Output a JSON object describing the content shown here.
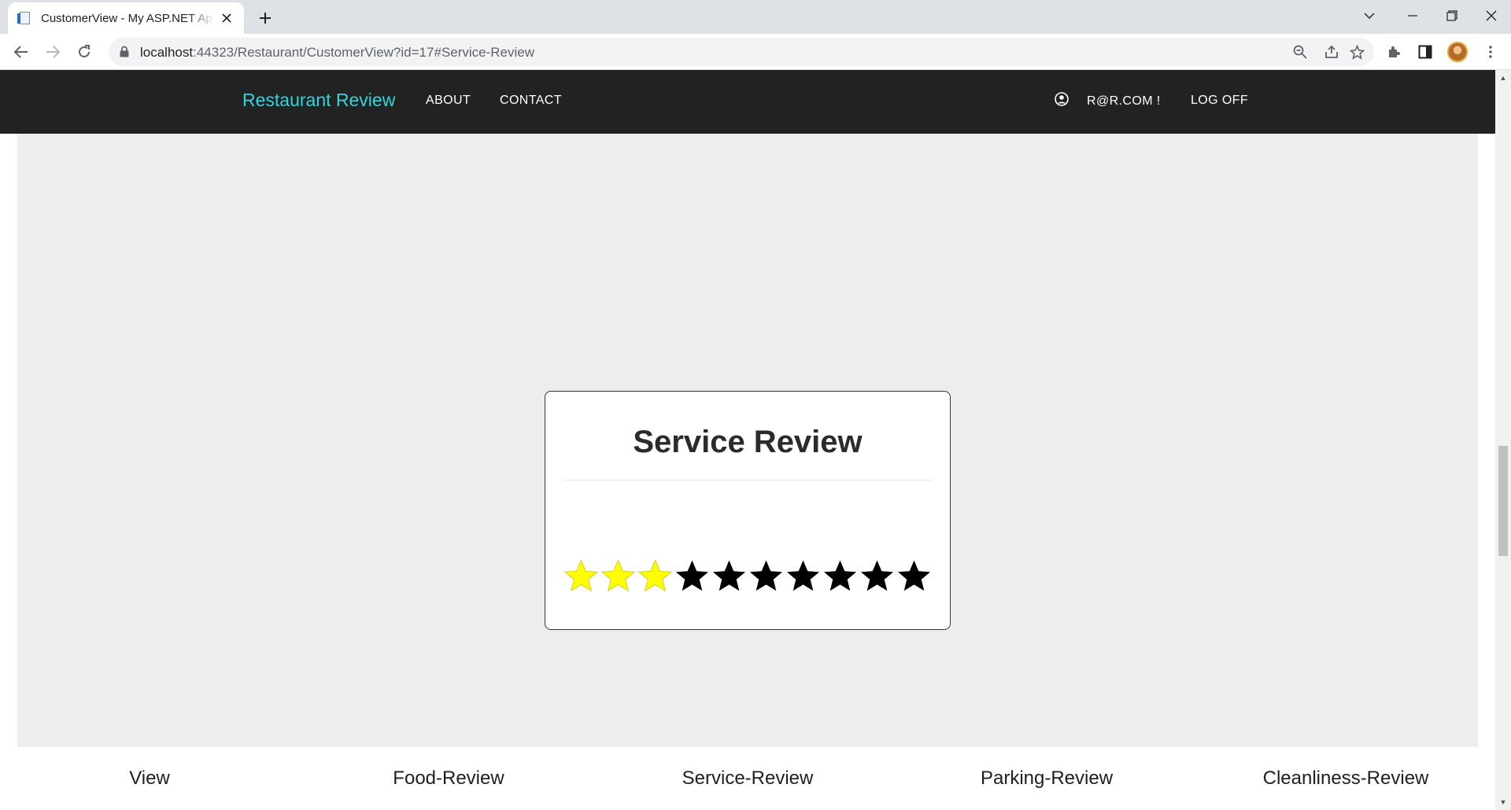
{
  "browser": {
    "tab_title": "CustomerView - My ASP.NET Application",
    "url_host": "localhost",
    "url_rest": ":44323/Restaurant/CustomerView?id=17#Service-Review"
  },
  "navbar": {
    "brand": "Restaurant Review",
    "links": [
      "ABOUT",
      "CONTACT"
    ],
    "user": "R@R.COM !",
    "logoff": "LOG OFF"
  },
  "review": {
    "title": "Service Review",
    "rating": 3,
    "max_rating": 10,
    "filled_color": "#ffff00",
    "empty_color": "#000000"
  },
  "bottom_nav": {
    "items": [
      "View",
      "Food-Review",
      "Service-Review",
      "Parking-Review",
      "Cleanliness-Review"
    ]
  },
  "colors": {
    "navbar_bg": "#222222",
    "brand": "#2fd6dc",
    "content_bg": "#ededed"
  }
}
